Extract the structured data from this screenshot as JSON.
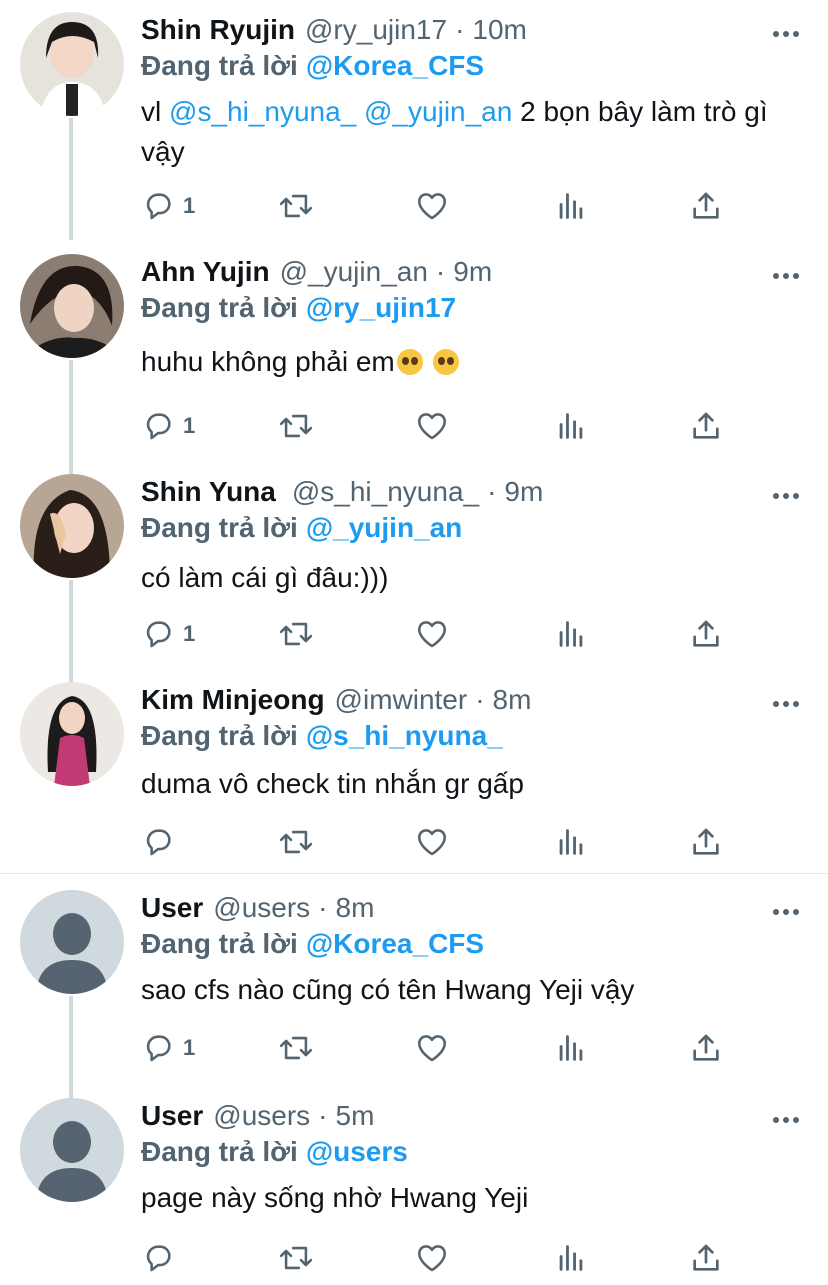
{
  "tweets": [
    {
      "name": "Shin Ryujin",
      "handle": "@ry_ujin17",
      "time": "10m",
      "replying_label": "Đang trả lời",
      "replying_to": "@Korea_CFS",
      "mention1": "@s_hi_nyuna_",
      "mention2": "@_yujin_an",
      "text_prefix": "vl",
      "text_main": "2 bọn bây làm trò gì vậy",
      "reply_count": "1"
    },
    {
      "name": "Ahn Yujin",
      "handle": "@_yujin_an",
      "time": "9m",
      "replying_label": "Đang trả lời",
      "replying_to": "@ry_ujin17",
      "text": "huhu không phải em",
      "reply_count": "1"
    },
    {
      "name": "Shin Yuna",
      "handle": "@s_hi_nyuna_",
      "time": "9m",
      "replying_label": "Đang trả lời",
      "replying_to": "@_yujin_an",
      "text": "có làm cái gì đâu:)))",
      "reply_count": "1"
    },
    {
      "name": "Kim Minjeong",
      "handle": "@imwinter",
      "time": "8m",
      "replying_label": "Đang trả lời",
      "replying_to": "@s_hi_nyuna_",
      "text": "duma vô check tin nhắn gr gấp",
      "reply_count": ""
    },
    {
      "name": "User",
      "handle": "@users",
      "time": "8m",
      "replying_label": "Đang trả lời",
      "replying_to": "@Korea_CFS",
      "text": "sao cfs nào cũng có tên Hwang Yeji vậy",
      "reply_count": "1"
    },
    {
      "name": "User",
      "handle": "@users",
      "time": "5m",
      "replying_label": "Đang trả lời",
      "replying_to": "@users",
      "text": "page này sống nhờ Hwang Yeji",
      "reply_count": ""
    }
  ],
  "icons": {
    "reply": "reply-icon",
    "retweet": "retweet-icon",
    "like": "heart-icon",
    "views": "views-icon",
    "share": "share-icon",
    "more": "more-icon"
  },
  "colors": {
    "link": "#1d9bf0",
    "secondary": "#536471",
    "thread": "#cfd9de"
  }
}
